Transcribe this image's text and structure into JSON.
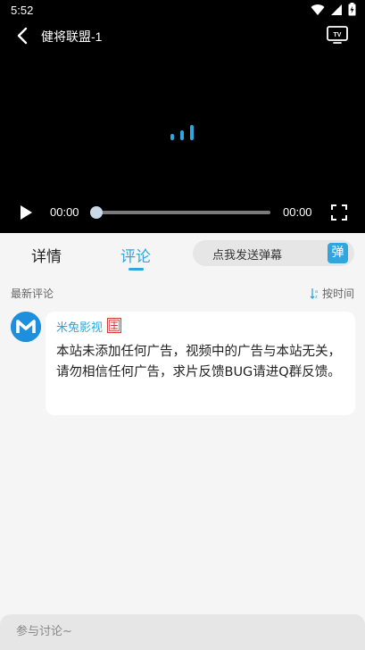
{
  "status_bar": {
    "time": "5:52",
    "icons": [
      "wifi-icon",
      "signal-icon",
      "battery-icon"
    ]
  },
  "player": {
    "title": "健将联盟-1",
    "current_time": "00:00",
    "total_time": "00:00",
    "progress": 0,
    "icons": [
      "back-icon",
      "tv-cast-icon",
      "loading-icon",
      "play-icon",
      "fullscreen-icon"
    ]
  },
  "tabs": {
    "items": [
      {
        "label": "详情",
        "active": false
      },
      {
        "label": "评论",
        "active": true
      }
    ],
    "danmu_placeholder": "点我发送弹幕",
    "danmu_button": "弹"
  },
  "comments": {
    "section_title": "最新评论",
    "sort_label": "按时间",
    "items": [
      {
        "author": "米兔影视",
        "text": "本站未添加任何广告，视频中的广告与本站无关，请勿相信任何广告，求片反馈BUG请进Q群反馈。"
      }
    ]
  },
  "bottom_input": {
    "placeholder": "参与讨论~"
  },
  "colors": {
    "accent": "#2ea7e0",
    "video_bg": "#000000",
    "page_bg": "#f5f5f5"
  }
}
